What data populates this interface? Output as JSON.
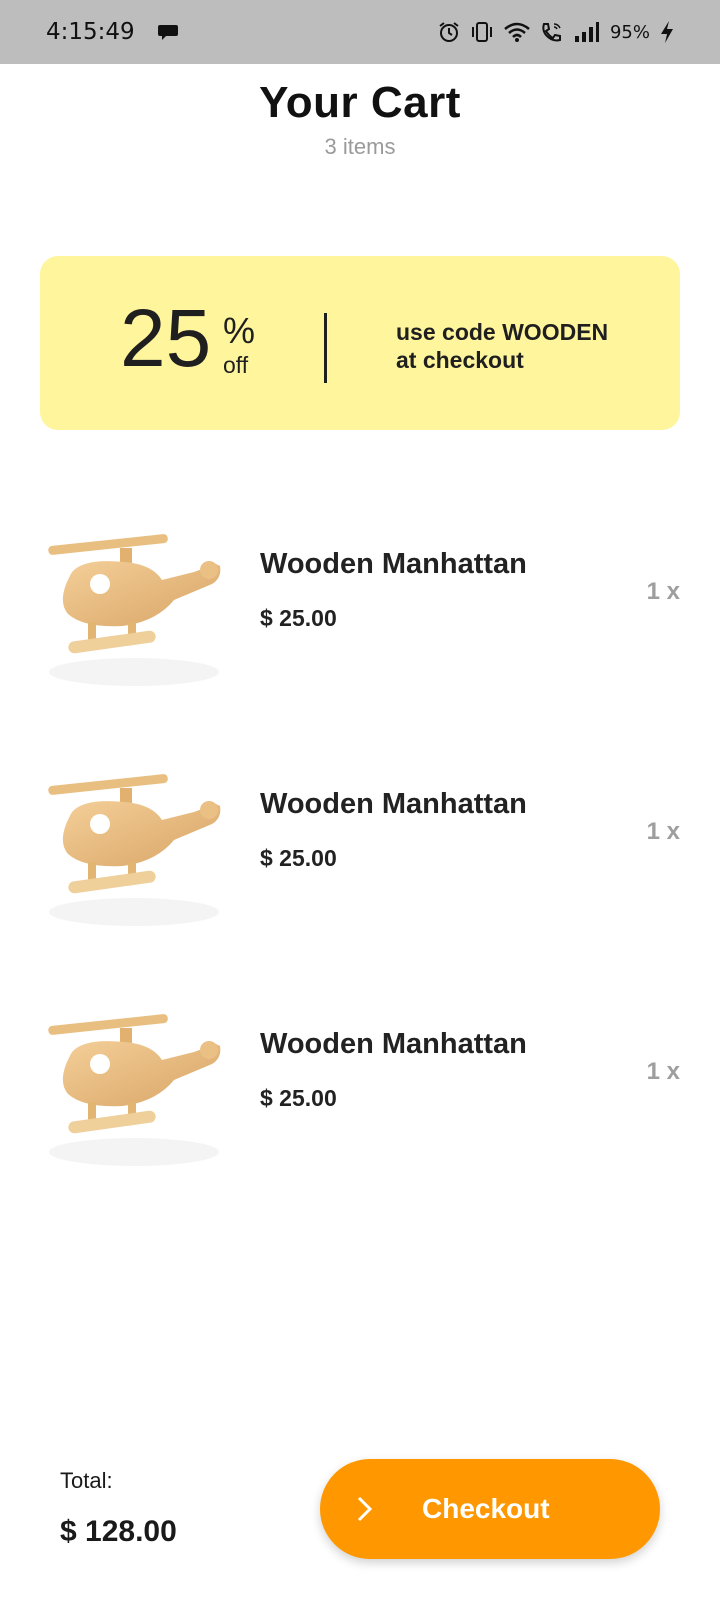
{
  "status_bar": {
    "time": "4:15:49",
    "battery": "95%",
    "icons": [
      "chat-bubble-icon",
      "alarm-icon",
      "vibrate-icon",
      "wifi-icon",
      "wifi-call-icon",
      "signal-icon",
      "charging-icon"
    ]
  },
  "header": {
    "title": "Your Cart",
    "subtitle": "3 items"
  },
  "promo": {
    "percent": "25",
    "percent_sign": "%",
    "off_label": "off",
    "code_line1": "use code WOODEN",
    "code_line2": "at checkout",
    "background": "#fff59d"
  },
  "items": [
    {
      "name": "Wooden Manhattan",
      "price": "$ 25.00",
      "quantity": "1 x",
      "image": "wooden-helicopter-image"
    },
    {
      "name": "Wooden Manhattan",
      "price": "$ 25.00",
      "quantity": "1 x",
      "image": "wooden-helicopter-image"
    },
    {
      "name": "Wooden Manhattan",
      "price": "$ 25.00",
      "quantity": "1 x",
      "image": "wooden-helicopter-image"
    }
  ],
  "footer": {
    "total_label": "Total:",
    "total_value": "$ 128.00",
    "checkout_label": "Checkout",
    "checkout_icon": "chevron-right-icon",
    "accent": "#ff9800"
  }
}
